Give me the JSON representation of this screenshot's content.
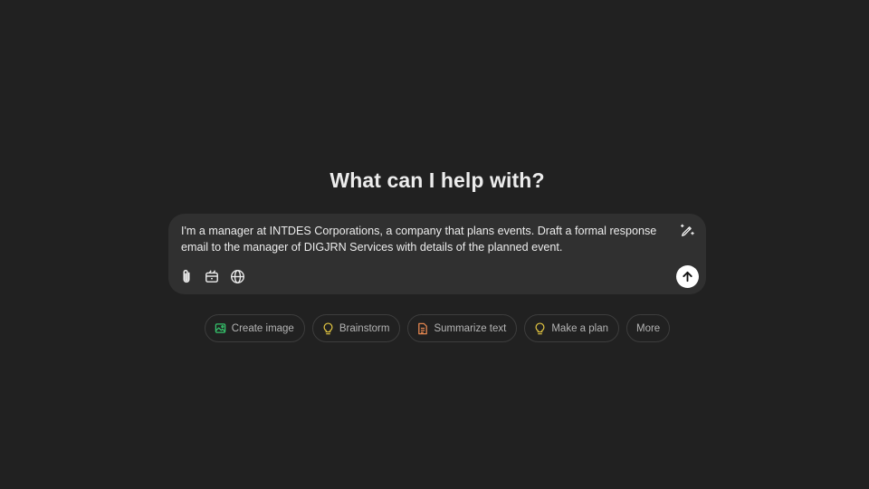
{
  "main": {
    "heading": "What can I help with?"
  },
  "composer": {
    "text": "I'm a manager at INTDES Corporations, a company that plans events. Draft a formal response\nemail to the manager of DIGJRN Services with details of the planned event.",
    "icons": {
      "magic": "pencil-sparkle-icon",
      "attach": "paperclip-icon",
      "tools": "toolbox-icon",
      "web": "globe-icon",
      "send": "arrow-up-icon"
    }
  },
  "suggestions": [
    {
      "label": "Create image",
      "icon": "image-icon",
      "color": "#35c26b"
    },
    {
      "label": "Brainstorm",
      "icon": "lightbulb-icon",
      "color": "#e2c541"
    },
    {
      "label": "Summarize text",
      "icon": "document-icon",
      "color": "#e2854f"
    },
    {
      "label": "Make a plan",
      "icon": "lightbulb-icon",
      "color": "#e2c541"
    },
    {
      "label": "More",
      "icon": "",
      "color": ""
    }
  ],
  "colors": {
    "background": "#212121",
    "composer": "#303030",
    "text": "#ececec",
    "muted": "#b4b4b4"
  }
}
